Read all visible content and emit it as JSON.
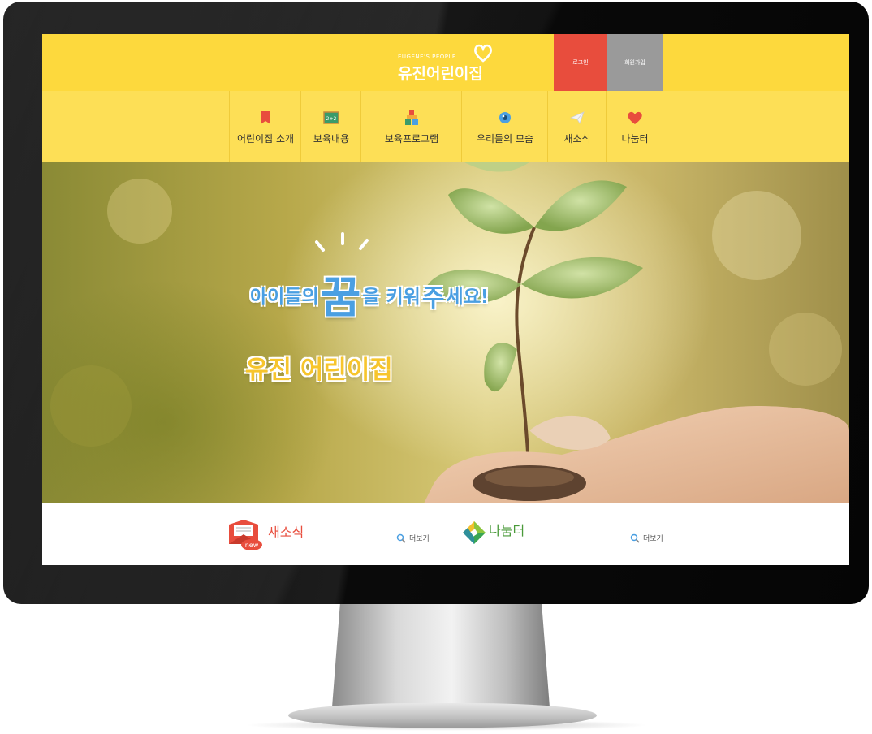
{
  "site": {
    "logo_sub": "EUGENE'S PEOPLE",
    "logo_main": "유진어린이집"
  },
  "header": {
    "login_label": "로그인",
    "join_label": "회원가입"
  },
  "nav": {
    "items": [
      {
        "label": "어린이집 소개",
        "icon": "bookmark-icon"
      },
      {
        "label": "보육내용",
        "icon": "blackboard-icon",
        "icon_text": "2+2"
      },
      {
        "label": "보육프로그램",
        "icon": "blocks-icon"
      },
      {
        "label": "우리들의 모습",
        "icon": "eye-icon"
      },
      {
        "label": "새소식",
        "icon": "paper-plane-icon"
      },
      {
        "label": "나눔터",
        "icon": "heart-icon"
      }
    ]
  },
  "hero": {
    "line1_a": "아이들의",
    "line1_b": "꿈",
    "line1_c": "을 키워",
    "line1_d": "주",
    "line1_e": "세요!",
    "line2": "유진 어린이집"
  },
  "sections": {
    "news_title": "새소식",
    "news_badge": "new",
    "news_more": "더보기",
    "share_title": "나눔터",
    "share_more": "더보기"
  },
  "colors": {
    "topbar": "#fdd93d",
    "navbar": "#fddf56",
    "login": "#e84d3d",
    "join": "#9a9a9a",
    "hero_blue": "#4a9fe2",
    "hero_yellow": "#f7c52c"
  }
}
